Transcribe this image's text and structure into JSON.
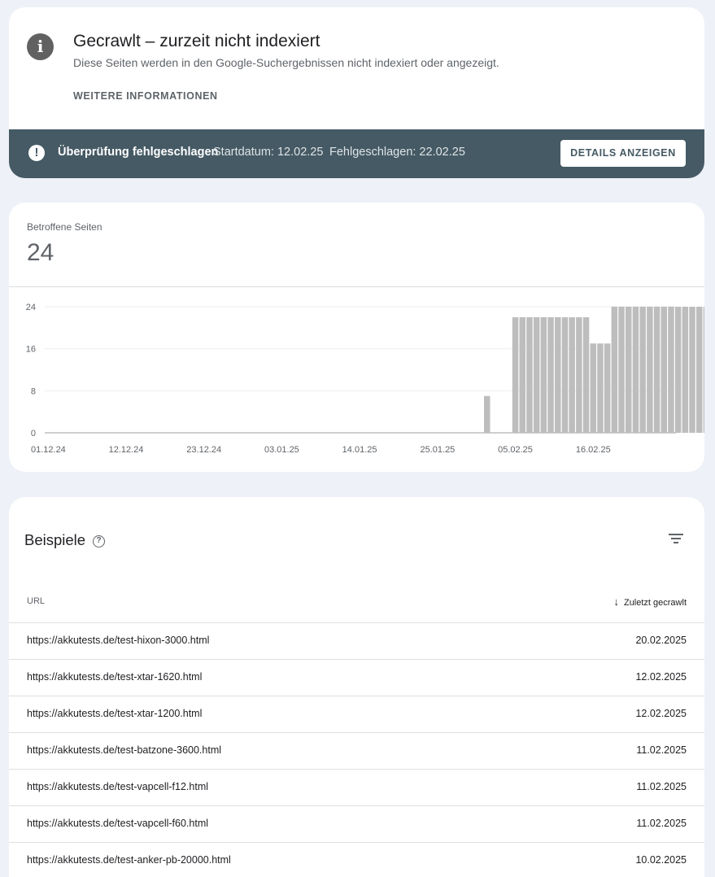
{
  "issue": {
    "title": "Gecrawlt – zurzeit nicht indexiert",
    "description": "Diese Seiten werden in den Google-Suchergebnissen nicht indexiert oder angezeigt.",
    "more_info_label": "WEITERE INFORMATIONEN",
    "info_icon": "info-icon"
  },
  "validation": {
    "status": "Überprüfung fehlgeschlagen",
    "start": "Startdatum: 12.02.25",
    "failed": "Fehlgeschlagen: 22.02.25",
    "details_button": "DETAILS ANZEIGEN",
    "bar_color": "#455a64"
  },
  "affected": {
    "label": "Betroffene Seiten",
    "value": "24"
  },
  "chart_data": {
    "type": "bar",
    "x_start": "01.12.24",
    "x_tick_labels": [
      "01.12.24",
      "12.12.24",
      "23.12.24",
      "03.01.25",
      "14.01.25",
      "25.01.25",
      "05.02.25",
      "16.02.25"
    ],
    "y_tick_labels": [
      "0",
      "8",
      "16",
      "24"
    ],
    "ylim": [
      0,
      24
    ],
    "bar_color": "#bdbdbd",
    "values": [
      0,
      0,
      0,
      0,
      0,
      0,
      0,
      0,
      0,
      0,
      0,
      0,
      0,
      0,
      0,
      0,
      0,
      0,
      0,
      0,
      0,
      0,
      0,
      0,
      0,
      0,
      0,
      0,
      0,
      0,
      0,
      0,
      0,
      0,
      0,
      0,
      0,
      0,
      0,
      0,
      0,
      0,
      0,
      0,
      0,
      0,
      0,
      0,
      0,
      0,
      0,
      0,
      0,
      0,
      0,
      0,
      0,
      0,
      0,
      0,
      0,
      0,
      7,
      0,
      0,
      0,
      22,
      22,
      22,
      22,
      22,
      22,
      22,
      22,
      22,
      22,
      22,
      17,
      17,
      17,
      24,
      24,
      24,
      24,
      24,
      24,
      24,
      24,
      24,
      24,
      24,
      24,
      24,
      24,
      24
    ],
    "grid": true
  },
  "examples": {
    "title": "Beispiele",
    "col_url": "URL",
    "col_date": "Zuletzt gecrawlt",
    "rows": [
      {
        "url": "https://akkutests.de/test-hixon-3000.html",
        "date": "20.02.2025"
      },
      {
        "url": "https://akkutests.de/test-xtar-1620.html",
        "date": "12.02.2025"
      },
      {
        "url": "https://akkutests.de/test-xtar-1200.html",
        "date": "12.02.2025"
      },
      {
        "url": "https://akkutests.de/test-batzone-3600.html",
        "date": "11.02.2025"
      },
      {
        "url": "https://akkutests.de/test-vapcell-f12.html",
        "date": "11.02.2025"
      },
      {
        "url": "https://akkutests.de/test-vapcell-f60.html",
        "date": "11.02.2025"
      },
      {
        "url": "https://akkutests.de/test-anker-pb-20000.html",
        "date": "10.02.2025"
      }
    ]
  }
}
